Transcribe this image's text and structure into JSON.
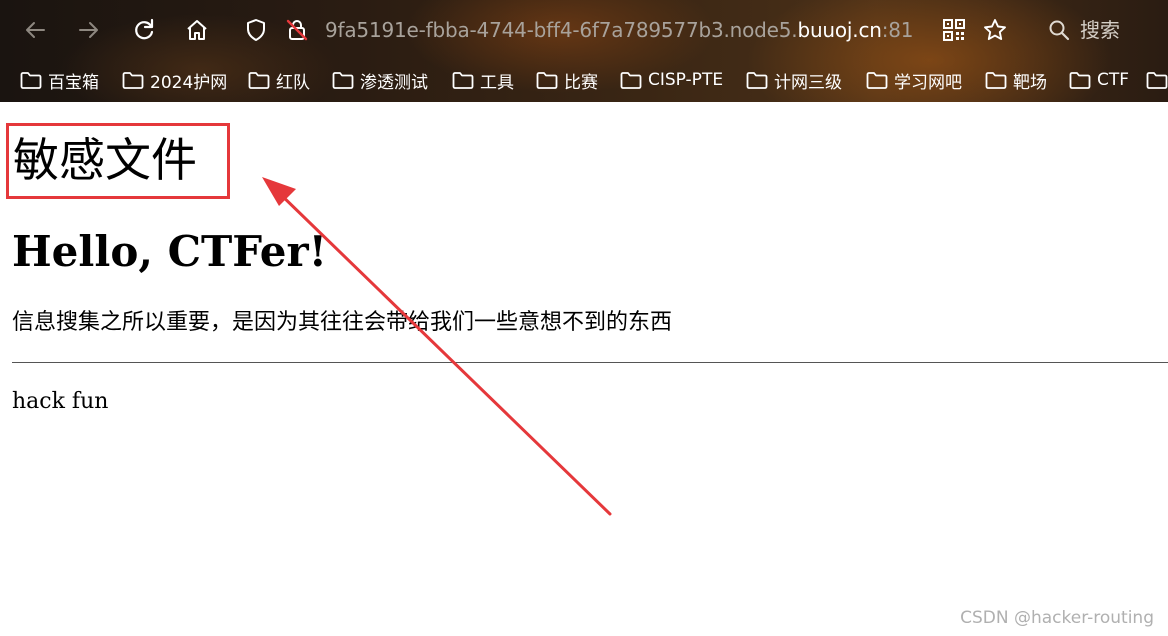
{
  "browser": {
    "url_prefix": "9fa5191e-fbba-4744-bff4-6f7a789577b3.node5.",
    "url_domain": "buuoj.cn",
    "url_suffix": ":81",
    "search_label": "搜索",
    "icons": {
      "back": "arrow-left-icon",
      "forward": "arrow-right-icon",
      "reload": "reload-icon",
      "home": "home-icon",
      "shield": "shield-icon",
      "insecure": "insecure-lock-icon",
      "qr": "qr-code-icon",
      "bookmark_star": "star-icon",
      "search": "search-icon"
    }
  },
  "bookmarks": [
    {
      "label": "百宝箱"
    },
    {
      "label": "2024护网"
    },
    {
      "label": "红队"
    },
    {
      "label": "渗透测试"
    },
    {
      "label": "工具"
    },
    {
      "label": "比赛"
    },
    {
      "label": "CISP-PTE"
    },
    {
      "label": "计网三级"
    },
    {
      "label": "学习网吧"
    },
    {
      "label": "靶场"
    },
    {
      "label": "CTF"
    }
  ],
  "page": {
    "title": "敏感文件",
    "heading": "Hello, CTFer!",
    "description": "信息搜集之所以重要，是因为其往往会带给我们一些意想不到的东西",
    "footer": "hack fun"
  },
  "annotation": {
    "highlight_color": "#e5383b"
  },
  "watermark": "CSDN @hacker-routing"
}
